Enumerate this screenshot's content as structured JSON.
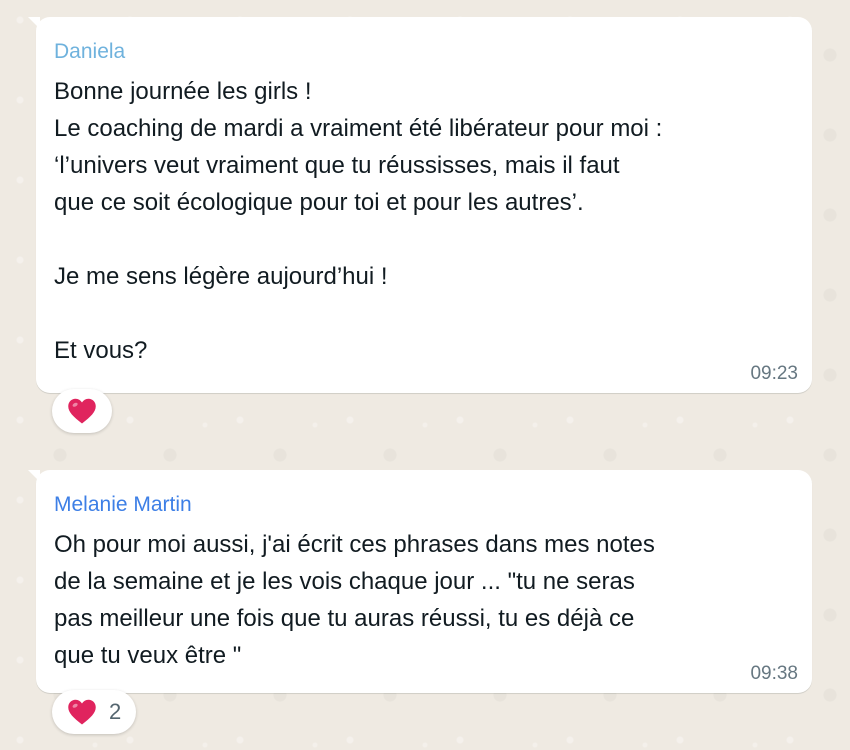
{
  "messages": [
    {
      "sender": "Daniela",
      "sender_color": "#6fb2dd",
      "text": "Bonne journée les girls !\nLe coaching de mardi a vraiment été libérateur pour moi :\n‘l’univers veut vraiment que tu réussisses, mais il faut\nque ce soit écologique pour toi et pour les autres’.\n\nJe me sens légère aujourd’hui !\n\nEt vous?",
      "time": "09:23",
      "reaction": {
        "icon": "heart-icon",
        "color": "#e0245e",
        "count": ""
      }
    },
    {
      "sender": "Melanie Martin",
      "sender_color": "#3d7fe6",
      "text": "Oh pour moi aussi, j'ai écrit ces phrases dans mes notes\nde la semaine et je les vois chaque jour ... \"tu ne seras\npas meilleur une fois que tu auras réussi, tu es déjà ce\nque tu veux être \"",
      "time": "09:38",
      "reaction": {
        "icon": "heart-icon",
        "color": "#e0245e",
        "count": "2"
      }
    }
  ]
}
